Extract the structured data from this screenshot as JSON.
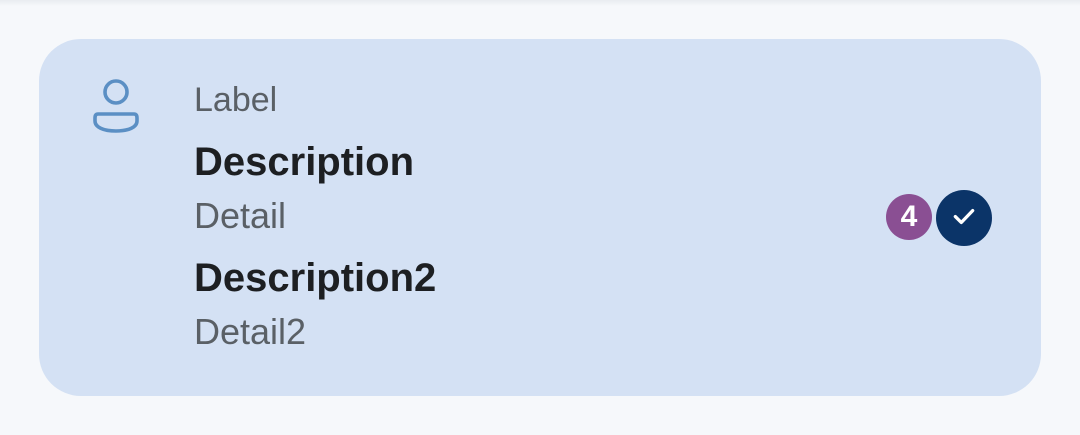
{
  "card": {
    "label": "Label",
    "description": "Description",
    "detail": "Detail",
    "description2": "Description2",
    "detail2": "Detail2",
    "badge_count": "4",
    "leading_icon": "person-icon",
    "trailing_icon": "check-icon"
  },
  "colors": {
    "card_background": "#d4e1f4",
    "icon_color": "#5b8fc4",
    "badge_background": "#8a4f93",
    "check_background": "#0b3468"
  }
}
